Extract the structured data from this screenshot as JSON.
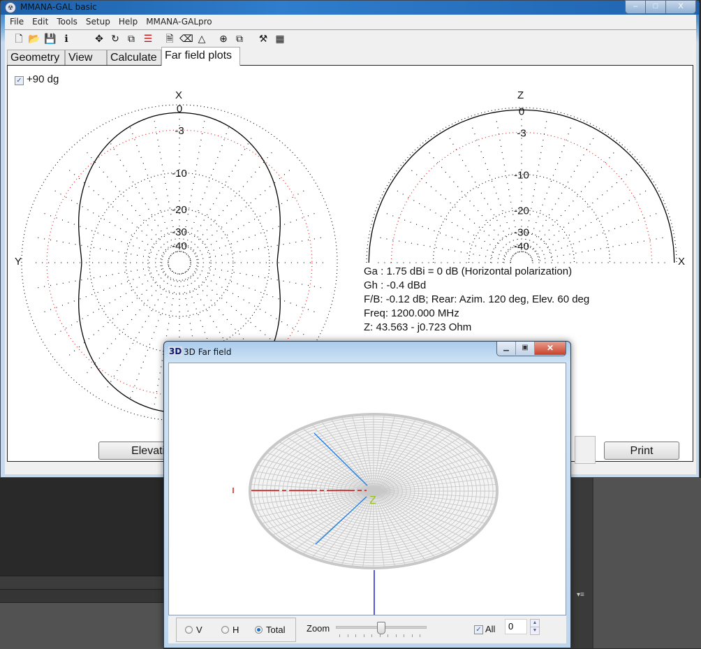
{
  "main_window": {
    "title": "MMANA-GAL basic",
    "controls": {
      "minimize": "–",
      "maximize": "□",
      "close": "X"
    },
    "menu": [
      "File",
      "Edit",
      "Tools",
      "Setup",
      "Help",
      "MMANA-GALpro"
    ],
    "toolbar": [
      {
        "name": "new-file-icon",
        "glyph": "🗋"
      },
      {
        "name": "open-folder-icon",
        "glyph": "📂"
      },
      {
        "name": "save-icon",
        "glyph": "💾"
      },
      {
        "name": "info-icon",
        "glyph": "ℹ"
      },
      {
        "name": "move-icon",
        "glyph": "✥"
      },
      {
        "name": "rotate-icon",
        "glyph": "↻"
      },
      {
        "name": "scale-icon",
        "glyph": "⧉"
      },
      {
        "name": "segments-icon",
        "glyph": "☰"
      },
      {
        "name": "document-icon",
        "glyph": "🗎"
      },
      {
        "name": "eraser-icon",
        "glyph": "⌫"
      },
      {
        "name": "triangle-icon",
        "glyph": "△"
      },
      {
        "name": "target-icon",
        "glyph": "⊕"
      },
      {
        "name": "copy-icon",
        "glyph": "⧉"
      },
      {
        "name": "tools-icon",
        "glyph": "⚒"
      },
      {
        "name": "calculator-icon",
        "glyph": "▦"
      }
    ],
    "tabs": [
      {
        "label": "Geometry",
        "active": false
      },
      {
        "label": "View",
        "active": false
      },
      {
        "label": "Calculate",
        "active": false
      },
      {
        "label": "Far field plots",
        "active": true
      }
    ]
  },
  "far_field": {
    "checkbox_90": {
      "label": "+90 dg",
      "checked": true
    },
    "horizontal_plot": {
      "top_axis": "X",
      "left_axis": "Y"
    },
    "vertical_plot": {
      "top_axis": "Z",
      "right_axis": "X"
    },
    "ring_labels": [
      "0",
      "-3",
      "-10",
      "-20",
      "-30",
      "-40"
    ],
    "info_lines": [
      "Ga : 1.75 dBi = 0 dB  (Horizontal polarization)",
      "Gh : -0.4 dBd",
      "F/B: -0.12 dB; Rear: Azim. 120 deg,  Elev. 60 deg",
      "Freq: 1200.000 MHz",
      "Z: 43.563 - j0.723 Ohm"
    ],
    "buttons": {
      "elevation": "Elevation",
      "print": "Print"
    }
  },
  "window_3d": {
    "icon_text": "3D",
    "title": "3D Far field",
    "axis_label": "Z",
    "polarization": {
      "options": [
        "V",
        "H",
        "Total"
      ],
      "selected": "Total"
    },
    "zoom_label": "Zoom",
    "zoom_level": 0.5,
    "all_checkbox": {
      "label": "All",
      "checked": true
    },
    "spin_value": "0",
    "colors": {
      "mesh": "#c8c8c8",
      "x_axis": "#d01010",
      "y_axis": "#1e7ee8",
      "z_axis": "#1010d0",
      "z_label": "#9ac020"
    }
  }
}
